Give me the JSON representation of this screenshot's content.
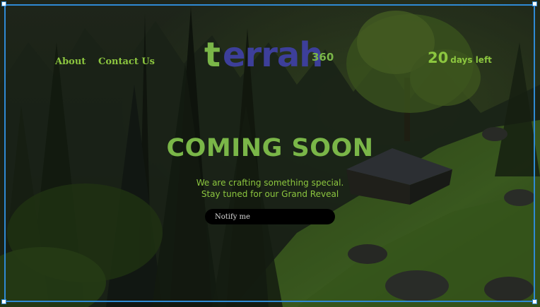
{
  "nav": {
    "about_label": "About",
    "contact_label": "Contact Us"
  },
  "logo": {
    "t": "t",
    "rest": "errah",
    "suffix": "360"
  },
  "countdown": {
    "number": "20",
    "label": "days left"
  },
  "hero": {
    "headline": "COMING SOON",
    "tagline_line1": "We are crafting something special.",
    "tagline_line2": "Stay tuned for our Grand Reveal"
  },
  "notify": {
    "placeholder": "Notify me"
  },
  "colors": {
    "accent_green": "#8cc63f",
    "logo_blue": "#3d3f9a",
    "selection_blue": "#2f8ad4"
  },
  "icons": {
    "background": "forest-cabin-image"
  }
}
